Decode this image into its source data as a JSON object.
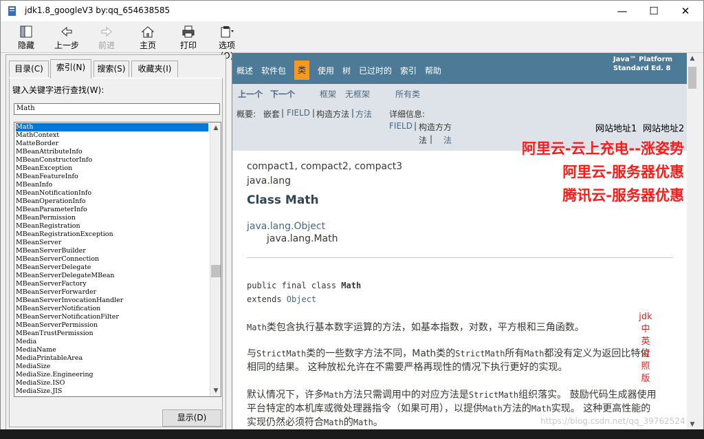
{
  "window": {
    "title": "jdk1.8_googleV3 by:qq_654638585",
    "min": "—",
    "max": "☐",
    "close": "✕"
  },
  "toolbar": {
    "hide": "隐藏",
    "back": "上一步",
    "forward": "前进",
    "home": "主页",
    "print": "打印",
    "options": "选项(O)"
  },
  "left": {
    "tabs": [
      "目录(C)",
      "索引(N)",
      "搜索(S)",
      "收藏夹(I)"
    ],
    "keyword_label": "键入关键字进行查找(W):",
    "keyword_value": "Math",
    "items": [
      "Math",
      "MathContext",
      "MatteBorder",
      "MBeanAttributeInfo",
      "MBeanConstructorInfo",
      "MBeanException",
      "MBeanFeatureInfo",
      "MBeanInfo",
      "MBeanNotificationInfo",
      "MBeanOperationInfo",
      "MBeanParameterInfo",
      "MBeanPermission",
      "MBeanRegistration",
      "MBeanRegistrationException",
      "MBeanServer",
      "MBeanServerBuilder",
      "MBeanServerConnection",
      "MBeanServerDelegate",
      "MBeanServerDelegateMBean",
      "MBeanServerFactory",
      "MBeanServerForwarder",
      "MBeanServerInvocationHandler",
      "MBeanServerNotification",
      "MBeanServerNotificationFilter",
      "MBeanServerPermission",
      "MBeanTrustPermission",
      "Media",
      "MediaName",
      "MediaPrintableArea",
      "MediaSize",
      "MediaSize.Engineering",
      "MediaSize.ISO",
      "MediaSize.JIS"
    ],
    "show_button": "显示(D)"
  },
  "nav": {
    "items": [
      "概述",
      "软件包",
      "类",
      "使用",
      "树",
      "已过时的",
      "索引",
      "帮助"
    ],
    "active": "类",
    "platform1": "Java™ Platform",
    "platform2": "Standard Ed. 8"
  },
  "subnav": {
    "prev": "上一个",
    "next": "下一个",
    "frames": "框架",
    "noframes": "无框架",
    "allclasses": "所有类",
    "summary_label": "概要:",
    "nested": "嵌套",
    "field": "FIELD",
    "sep": "|",
    "constr": "构造方法",
    "method": "方法",
    "detail_label": "详细信息:",
    "dfield": "FIELD",
    "dconstr1": "构造方方",
    "dconstr2": "法",
    "dmethod": "法"
  },
  "ads": {
    "site1": "网站地址1",
    "site2": "网站地址2",
    "promo1": "阿里云-云上充电--涨姿势",
    "promo2": "阿里云-服务器优惠",
    "promo3": "腾讯云-服务器优惠",
    "vert": [
      "jdk",
      "中",
      "英",
      "对",
      "照",
      "版"
    ]
  },
  "content": {
    "profiles": "compact1, compact2, compact3",
    "package": "java.lang",
    "class_title": "Class Math",
    "inherit1": "java.lang.Object",
    "inherit2": "java.lang.Math",
    "decl1": "public final class ",
    "decl_name": "Math",
    "decl2": "extends ",
    "decl_obj": "Object",
    "p1a": "Math",
    "p1b": "类包含执行基本数字运算的方法，如基本指数，对数，平方根和三角函数。",
    "p2a": "与",
    "p2b": "StrictMath",
    "p2c": "类的一些数字方法不同，Math类的",
    "p2d": "StrictMath",
    "p2e": "所有",
    "p2f": "Math",
    "p2g": "都没有定义为返回比特位",
    "p2line2": "相同的结果。 这种放松允许在不需要严格再现性的情况下执行更好的实现。",
    "p3a": "默认情况下，许多",
    "p3b": "Math",
    "p3c": "方法只需调用中的对应方法是",
    "p3d": "StrictMath",
    "p3e": "组织落实。 鼓励代码生成器使用",
    "p3line2a": "平台特定的本机库或微处理器指令（如果可用），以提供",
    "p3line2b": "Math",
    "p3line2c": "方法的",
    "p3line2d": "Math",
    "p3line2e": "实现。 这种更高性能的",
    "p3line3a": "实现仍然必须符合",
    "p3line3b": "Math",
    "p3line3c": "的",
    "p3line3d": "Math",
    "p3line3e": "。",
    "watermark": "https://blog.csdn.net/qq_39762524"
  },
  "colors": {
    "nav": "#4d7a97",
    "active": "#f8981d",
    "subnav": "#dee3e9",
    "link": "#4a6782",
    "promo": "#ff1a1a",
    "select": "#0078d7"
  }
}
